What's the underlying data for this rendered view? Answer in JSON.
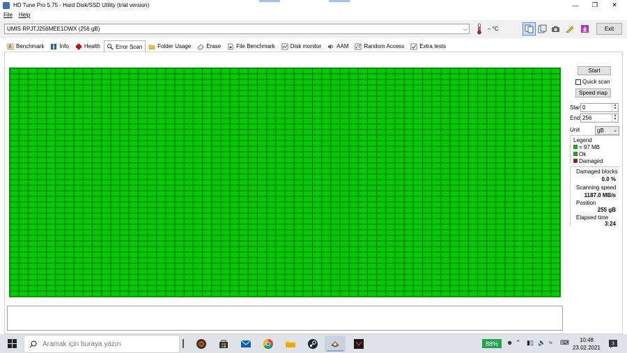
{
  "window": {
    "title": "HD Tune Pro 5.75 - Hard Disk/SSD Utility (trial version)"
  },
  "menu": {
    "file": "File",
    "help": "Help"
  },
  "toolbar": {
    "drive": "UMIS RPJTJ256MEE1OWX (256 gB)",
    "temperature": "– °C",
    "exit_label": "Exit"
  },
  "tabs": [
    {
      "label": "Benchmark",
      "icon": "benchmark-icon"
    },
    {
      "label": "Info",
      "icon": "info-icon"
    },
    {
      "label": "Health",
      "icon": "health-icon"
    },
    {
      "label": "Error Scan",
      "icon": "magnifier-icon",
      "active": true
    },
    {
      "label": "Folder Usage",
      "icon": "folder-icon"
    },
    {
      "label": "Erase",
      "icon": "erase-icon"
    },
    {
      "label": "File Benchmark",
      "icon": "file-icon"
    },
    {
      "label": "Disk monitor",
      "icon": "chart-icon"
    },
    {
      "label": "AAM",
      "icon": "speaker-icon"
    },
    {
      "label": "Random Access",
      "icon": "scatter-icon"
    },
    {
      "label": "Extra tests",
      "icon": "tests-icon"
    }
  ],
  "scan": {
    "columns": 60,
    "rows": 41,
    "ok_color": "#00cc00",
    "grid_color": "#006400"
  },
  "controls": {
    "start_label": "Start",
    "quick_scan_label": "Quick scan",
    "quick_scan_checked": false,
    "speed_map_label": "Speed map",
    "start_field_label": "Start",
    "start_value": "0",
    "end_field_label": "End",
    "end_value": "256",
    "unit_label": "Unit",
    "unit_value": "gB"
  },
  "legend": {
    "title": "Legend",
    "items": [
      {
        "label": "= 97 MB",
        "color": "#00cc00"
      },
      {
        "label": "Ok",
        "color": "#00cc00"
      },
      {
        "label": "Damaged",
        "color": "#cc0000"
      }
    ]
  },
  "stats": {
    "damaged_label": "Damaged blocks",
    "damaged_value": "0.0 %",
    "speed_label": "Scanning speed",
    "speed_value": "1187.0 MB/s",
    "position_label": "Position",
    "position_value": "255 gB",
    "elapsed_label": "Elapsed time",
    "elapsed_value": "3:24"
  },
  "taskbar": {
    "search_placeholder": "Aramak için buraya yazın",
    "apps": [
      {
        "name": "media-app-icon"
      },
      {
        "name": "store-icon"
      },
      {
        "name": "mail-icon"
      },
      {
        "name": "chrome-icon"
      },
      {
        "name": "file-explorer-icon"
      },
      {
        "name": "steam-icon"
      },
      {
        "name": "hdtune-icon",
        "running": true
      },
      {
        "name": "terminal-app-icon"
      }
    ],
    "battery": "88%",
    "time": "10:48",
    "date": "23.02.2021",
    "notifications": "3"
  }
}
